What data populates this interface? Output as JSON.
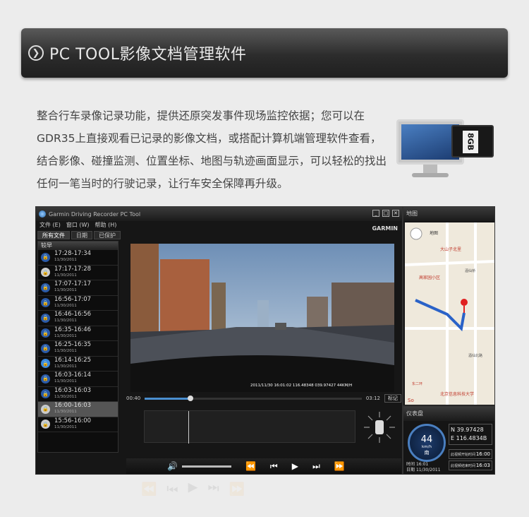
{
  "banner": {
    "title": "PC TOOL影像文档管理软件"
  },
  "description": "整合行车录像记录功能，提供还原突发事件现场监控依据；您可以在GDR35上直接观看已记录的影像文档，或搭配计算机端管理软件查看，结合影像、碰撞监测、位置坐标、地图与轨迹画面显示，可以轻松的找出任何一笔当时的行驶记录，让行车安全保障再升级。",
  "sdcard_label": "8GB",
  "app": {
    "title": "Garmin Driving Recorder PC Tool",
    "brand": "GARMIN",
    "menu": [
      "文件 (E)",
      "窗口 (W)",
      "帮助 (H)"
    ],
    "tabs": [
      "所有文件",
      "日期",
      "已保护"
    ],
    "sort_label": "较早",
    "records": [
      {
        "time": "17:28-17:34",
        "date": "11/30/2011"
      },
      {
        "time": "17:17-17:28",
        "date": "11/30/2011"
      },
      {
        "time": "17:07-17:17",
        "date": "11/30/2011"
      },
      {
        "time": "16:56-17:07",
        "date": "11/30/2011"
      },
      {
        "time": "16:46-16:56",
        "date": "11/30/2011"
      },
      {
        "time": "16:35-16:46",
        "date": "11/30/2011"
      },
      {
        "time": "16:25-16:35",
        "date": "11/30/2011"
      },
      {
        "time": "16:14-16:25",
        "date": "11/30/2011"
      },
      {
        "time": "16:03-16:14",
        "date": "11/30/2011"
      },
      {
        "time": "16:03-16:03",
        "date": "11/30/2011"
      },
      {
        "time": "16:00-16:03",
        "date": "11/30/2011"
      },
      {
        "time": "15:56-16:00",
        "date": "11/30/2011"
      }
    ],
    "video_hud": "2011/11/30  16:01:02    116.48348    039.97427    44KM/H",
    "time_current": "00:40",
    "time_total": "03:12",
    "mark_label": "标记",
    "progress": 0.21,
    "volume": 1.0
  },
  "map": {
    "title": "地图",
    "poi": [
      "地图",
      "大山子北里",
      "高家园小区",
      "酒仙桥",
      "北京信息科技大学",
      "东二环",
      "酒仙北路"
    ],
    "scale_label": "So"
  },
  "dash": {
    "title": "仪表盘",
    "speed": "44",
    "unit": "km/h",
    "dir": "南",
    "lat": "N 39.97428",
    "lon": "E 116.4834B",
    "time_label": "时间",
    "time": "16:01",
    "date_label": "日期",
    "date": "11/30/2011",
    "start_label": "此视频开始时间",
    "start": "16:00",
    "end_label": "此视频结束时间",
    "end": "16:03"
  }
}
